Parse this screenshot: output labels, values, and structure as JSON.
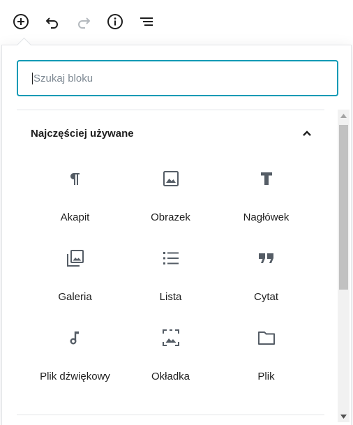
{
  "toolbar": {
    "items": [
      {
        "name": "add-block-button",
        "icon": "plus-circle-icon"
      },
      {
        "name": "undo-button",
        "icon": "undo-icon"
      },
      {
        "name": "redo-button",
        "icon": "redo-icon"
      },
      {
        "name": "info-button",
        "icon": "info-icon"
      },
      {
        "name": "outline-button",
        "icon": "list-outline-icon"
      }
    ]
  },
  "inserter": {
    "search": {
      "placeholder": "Szukaj bloku",
      "value": ""
    },
    "section": {
      "title": "Najczęściej używane",
      "expanded": true
    },
    "blocks": [
      {
        "label": "Akapit",
        "icon": "paragraph-icon"
      },
      {
        "label": "Obrazek",
        "icon": "image-icon"
      },
      {
        "label": "Nagłówek",
        "icon": "heading-icon"
      },
      {
        "label": "Galeria",
        "icon": "gallery-icon"
      },
      {
        "label": "Lista",
        "icon": "list-icon"
      },
      {
        "label": "Cytat",
        "icon": "quote-icon"
      },
      {
        "label": "Plik dźwiękowy",
        "icon": "audio-icon"
      },
      {
        "label": "Okładka",
        "icon": "cover-icon"
      },
      {
        "label": "Plik",
        "icon": "file-icon"
      }
    ]
  },
  "colors": {
    "accent": "#0e9ab5",
    "text": "#1e1e1e",
    "icon": "#555d66",
    "disabled": "#b4b9be",
    "border": "#e2e4e7"
  }
}
